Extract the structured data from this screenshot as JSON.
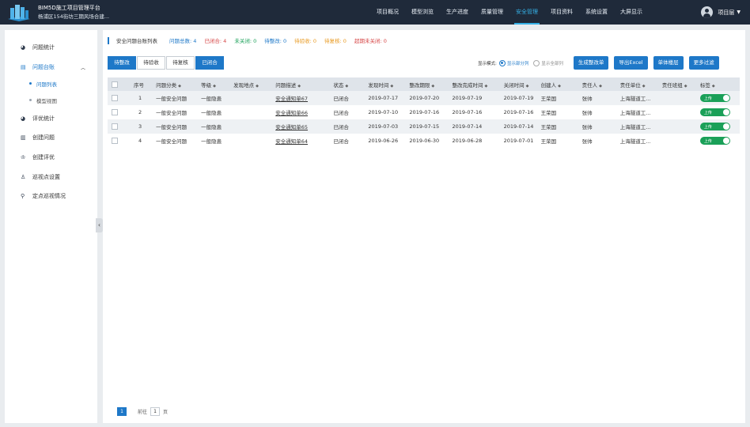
{
  "header": {
    "app_title": "BIM5D施工项目管理平台",
    "project_name": "杨浦区154街坊三期风场合建...",
    "nav": [
      {
        "label": "项目概况",
        "active": false
      },
      {
        "label": "模型浏览",
        "active": false
      },
      {
        "label": "生产进度",
        "active": false
      },
      {
        "label": "质量管理",
        "active": false
      },
      {
        "label": "安全管理",
        "active": true
      },
      {
        "label": "项目资料",
        "active": false
      },
      {
        "label": "系统设置",
        "active": false
      },
      {
        "label": "大屏显示",
        "active": false
      }
    ],
    "user": "项目层"
  },
  "sidebar": {
    "items": [
      {
        "label": "问题统计",
        "icon": "pie-chart-icon"
      },
      {
        "label": "问题台账",
        "icon": "ledger-icon"
      },
      {
        "label": "问题列表",
        "icon": ""
      },
      {
        "label": "模型视图",
        "icon": ""
      },
      {
        "label": "评优统计",
        "icon": "pie-chart-icon"
      },
      {
        "label": "创建问题",
        "icon": "book-icon"
      },
      {
        "label": "创建评优",
        "icon": "award-icon"
      },
      {
        "label": "巡视点设置",
        "icon": "inspection-icon"
      },
      {
        "label": "定点巡视情况",
        "icon": "location-icon"
      }
    ]
  },
  "summary": {
    "title": "安全问题台账列表",
    "stats": [
      {
        "label": "问题总数: 4",
        "color": "#1e78c8"
      },
      {
        "label": "已闭合: 4",
        "color": "#d64545"
      },
      {
        "label": "未关闭: 0",
        "color": "#1aa058"
      },
      {
        "label": "待整改: 0",
        "color": "#1e78c8"
      },
      {
        "label": "待验收: 0",
        "color": "#e89a22"
      },
      {
        "label": "待复核: 0",
        "color": "#e89a22"
      },
      {
        "label": "超期未关闭: 0",
        "color": "#d64545"
      }
    ]
  },
  "tabs": [
    "待整改",
    "待验收",
    "待复核",
    "已闭合"
  ],
  "controls": {
    "mode_label": "显示模式:",
    "radio_partial": "显示部分列",
    "radio_all": "显示全部列",
    "buttons": [
      "生成整改单",
      "导出Excel",
      "单体楼层",
      "更多过滤"
    ]
  },
  "table": {
    "columns": [
      "",
      "序号",
      "问题分类",
      "等级",
      "发现地点",
      "问题描述",
      "状态",
      "发现时间",
      "整改期限",
      "整改完成时间",
      "关闭时间",
      "创建人",
      "责任人",
      "责任单位",
      "责任班组",
      "标签"
    ],
    "rows": [
      [
        "1",
        "一般安全问题",
        "一般隐患",
        "",
        "安全通知单67",
        "已闭合",
        "2019-07-17",
        "2019-07-20",
        "2019-07-19",
        "2019-07-19",
        "王荣国",
        "张帅",
        "上海隧道工...",
        "",
        "上传"
      ],
      [
        "2",
        "一般安全问题",
        "一般隐患",
        "",
        "安全通知单66",
        "已闭合",
        "2019-07-10",
        "2019-07-16",
        "2019-07-16",
        "2019-07-16",
        "王荣国",
        "张帅",
        "上海隧道工...",
        "",
        "上传"
      ],
      [
        "3",
        "一般安全问题",
        "一般隐患",
        "",
        "安全通知单65",
        "已闭合",
        "2019-07-03",
        "2019-07-15",
        "2019-07-14",
        "2019-07-14",
        "王荣国",
        "张帅",
        "上海隧道工...",
        "",
        "上传"
      ],
      [
        "4",
        "一般安全问题",
        "一般隐患",
        "",
        "安全通知单64",
        "已闭合",
        "2019-06-26",
        "2019-06-30",
        "2019-06-28",
        "2019-07-01",
        "王荣国",
        "张帅",
        "上海隧道工...",
        "",
        "上传"
      ]
    ]
  },
  "pager": {
    "page": "1",
    "goto_label": "前往",
    "goto_value": "1",
    "page_unit": "页"
  }
}
